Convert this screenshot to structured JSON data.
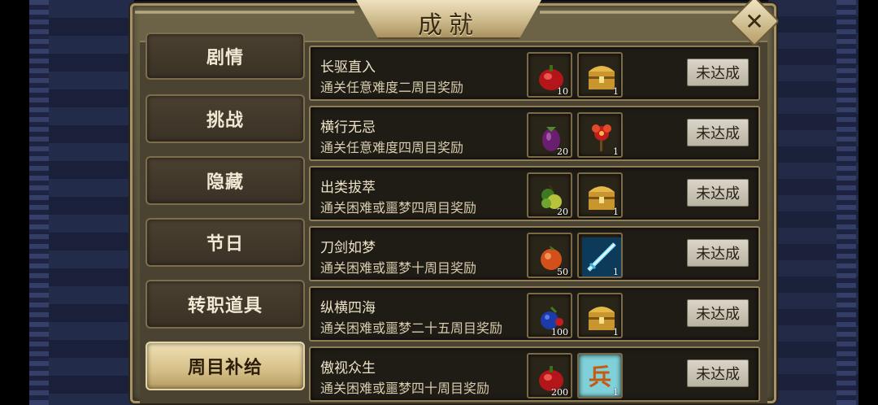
{
  "title": "成就",
  "close_label": "✕",
  "tabs": [
    {
      "label": "剧情",
      "active": false
    },
    {
      "label": "挑战",
      "active": false
    },
    {
      "label": "隐藏",
      "active": false
    },
    {
      "label": "节日",
      "active": false
    },
    {
      "label": "转职道具",
      "active": false
    },
    {
      "label": "周目补给",
      "active": true
    }
  ],
  "achievements": [
    {
      "name": "长驱直入",
      "desc": "通关任意难度二周目奖励",
      "rewards": [
        {
          "icon": "red-gourd-icon",
          "count": "10"
        },
        {
          "icon": "treasure-chest-icon",
          "count": "1"
        }
      ],
      "status": "未达成"
    },
    {
      "name": "横行无忌",
      "desc": "通关任意难度四周目奖励",
      "rewards": [
        {
          "icon": "purple-eggplant-icon",
          "count": "20"
        },
        {
          "icon": "red-flower-icon",
          "count": "1"
        }
      ],
      "status": "未达成"
    },
    {
      "name": "出类拔萃",
      "desc": "通关困难或噩梦四周目奖励",
      "rewards": [
        {
          "icon": "green-fruit-icon",
          "count": "20"
        },
        {
          "icon": "treasure-chest-icon",
          "count": "1"
        }
      ],
      "status": "未达成"
    },
    {
      "name": "刀剑如梦",
      "desc": "通关困难或噩梦十周目奖励",
      "rewards": [
        {
          "icon": "orange-fruit-icon",
          "count": "50"
        },
        {
          "icon": "blue-sword-icon",
          "count": "1"
        }
      ],
      "status": "未达成"
    },
    {
      "name": "纵横四海",
      "desc": "通关困难或噩梦二十五周目奖励",
      "rewards": [
        {
          "icon": "blue-berry-icon",
          "count": "100"
        },
        {
          "icon": "treasure-chest-icon",
          "count": "1"
        }
      ],
      "status": "未达成"
    },
    {
      "name": "傲视众生",
      "desc": "通关困难或噩梦四十周目奖励",
      "rewards": [
        {
          "icon": "red-gourd-icon",
          "count": "200"
        },
        {
          "icon": "soldier-card-icon",
          "count": "1",
          "label": "兵"
        }
      ],
      "status": "未达成"
    }
  ]
}
